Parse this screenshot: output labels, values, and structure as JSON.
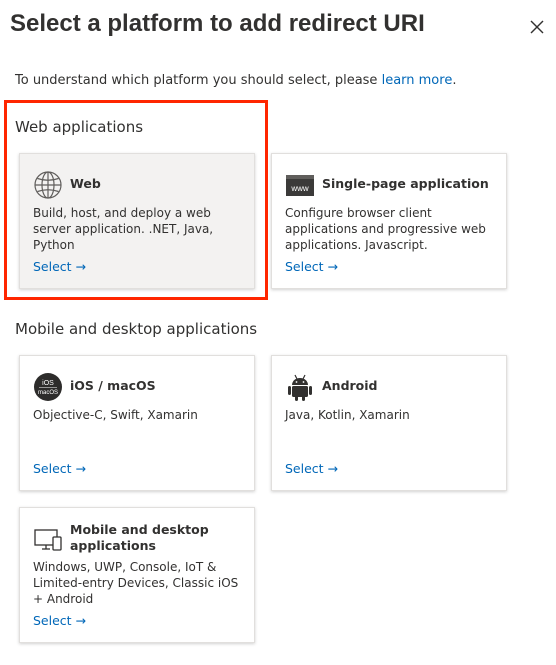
{
  "dialog": {
    "title": "Select a platform to add redirect URI",
    "intro_text": "To understand which platform you should select, please ",
    "intro_link": "learn more",
    "intro_end": "."
  },
  "sections": {
    "web": "Web applications",
    "mobile": "Mobile and desktop applications"
  },
  "cards": {
    "web": {
      "title": "Web",
      "description": "Build, host, and deploy a web server application. .NET, Java, Python",
      "select": "Select →",
      "icon": "globe-icon"
    },
    "spa": {
      "title": "Single-page application",
      "description": "Configure browser client applications and progressive web applications. Javascript.",
      "select": "Select →",
      "icon": "www-browser-icon",
      "icon_text": "www"
    },
    "ios": {
      "title": "iOS / macOS",
      "description": "Objective-C, Swift, Xamarin",
      "select": "Select →",
      "icon": "ios-macos-icon",
      "icon_text_top": "iOS",
      "icon_text_bottom": "macOS"
    },
    "android": {
      "title": "Android",
      "description": "Java, Kotlin, Xamarin",
      "select": "Select →",
      "icon": "android-icon"
    },
    "desktop": {
      "title": "Mobile and desktop applications",
      "description": "Windows, UWP, Console, IoT & Limited-entry Devices, Classic iOS + Android",
      "select": "Select →",
      "icon": "desktop-mobile-icon"
    }
  },
  "colors": {
    "link": "#0067b8",
    "highlight": "#ff2600",
    "active_card": "#f3f2f1"
  }
}
